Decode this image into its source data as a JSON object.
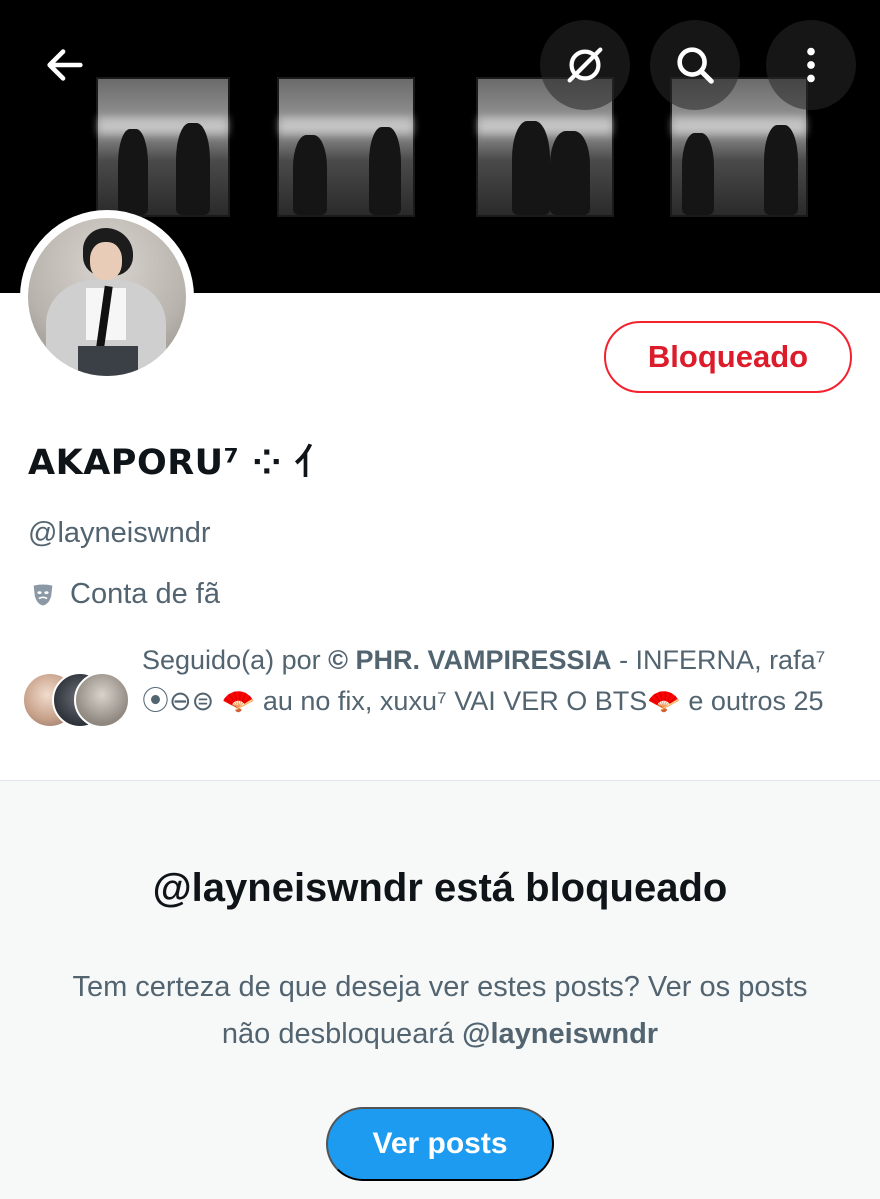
{
  "header": {
    "back_icon": "arrow-left-icon",
    "icons": [
      "broken-heart-icon",
      "search-icon",
      "more-vertical-icon"
    ]
  },
  "profile": {
    "block_button_label": "Bloqueado",
    "display_name": "AKAPORU⁷ ⁘ ⺅",
    "handle": "@layneiswndr",
    "label_icon": "theater-mask-icon",
    "label_text": "Conta de fã"
  },
  "followers": {
    "prefix": "Seguido(a) por ",
    "name1": "© PHR. VAMPIRESSIA",
    "rest": " - INFERNA, rafa⁷ ⦿⊖⊜ 🪭 au no fix, xuxu⁷ VAI VER O BTS🪭 e outros 25"
  },
  "blocked": {
    "title": "@layneiswndr está bloqueado",
    "desc_text": "Tem certeza de que deseja ver estes posts? Ver os posts não desbloqueará ",
    "desc_handle": "@layneiswndr",
    "view_button_label": "Ver posts"
  },
  "colors": {
    "accent_blue": "#1d9bf0",
    "block_red": "#f4212e",
    "secondary_text": "#536471"
  }
}
